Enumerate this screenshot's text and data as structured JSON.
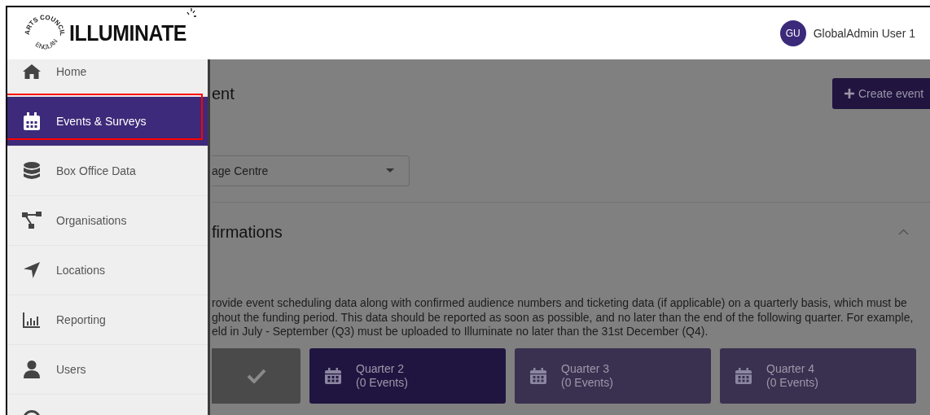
{
  "header": {
    "logo": {
      "ring_top": "ARTS COUNCIL",
      "ring_bottom": "ENGLAND",
      "wordmark": "ILLUMINATE"
    },
    "user": {
      "initials": "GU",
      "name": "GlobalAdmin User 1"
    }
  },
  "sidebar": {
    "items": [
      {
        "label": "Home",
        "kind": "home",
        "selected": false,
        "highlighted": false
      },
      {
        "label": "Events & Surveys",
        "kind": "calendar",
        "selected": true,
        "highlighted": true
      },
      {
        "label": "Box Office Data",
        "kind": "database",
        "selected": false,
        "highlighted": false
      },
      {
        "label": "Organisations",
        "kind": "sitemap",
        "selected": false,
        "highlighted": false
      },
      {
        "label": "Locations",
        "kind": "location",
        "selected": false,
        "highlighted": false
      },
      {
        "label": "Reporting",
        "kind": "chart",
        "selected": false,
        "highlighted": false
      },
      {
        "label": "Users",
        "kind": "user",
        "selected": false,
        "highlighted": false
      },
      {
        "kind": "help",
        "selected": false,
        "highlighted": false
      }
    ]
  },
  "main": {
    "title": "ent",
    "create_button": "Create event",
    "select": {
      "value": "age Centre"
    },
    "section": {
      "title": "firmations",
      "expanded": true,
      "paragraph_lines": [
        "rovide event scheduling data along with confirmed audience numbers and ticketing data (if applicable) on a quarterly basis, which must be",
        "ghout the funding period. This data should be reported as soon as possible, and no later than the end of the following quarter. For example,",
        "eld in July - September (Q3) must be uploaded to Illuminate no later than the 31st December (Q4)."
      ],
      "quarters": [
        {
          "kind": "done"
        },
        {
          "kind": "quarter",
          "title": "Quarter 2",
          "count": "(0 Events)",
          "selected": true
        },
        {
          "kind": "quarter",
          "title": "Quarter 3",
          "count": "(0 Events)",
          "selected": false
        },
        {
          "kind": "quarter",
          "title": "Quarter 4",
          "count": "(0 Events)",
          "selected": false
        }
      ]
    }
  }
}
